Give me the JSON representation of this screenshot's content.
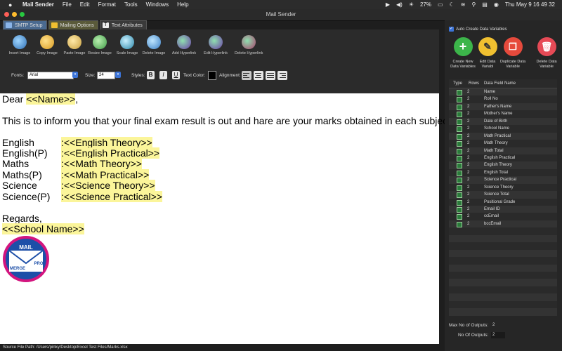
{
  "menubar": {
    "app": "Mail Sender",
    "items": [
      "File",
      "Edit",
      "Format",
      "Tools",
      "Windows",
      "Help"
    ],
    "battery": "27%",
    "clock": "Thu May 9  16 49 32"
  },
  "window": {
    "title": "Mail Sender"
  },
  "tabs": [
    {
      "label": "SMTP Setup"
    },
    {
      "label": "Mailing Options"
    },
    {
      "label": "Text Attributes"
    }
  ],
  "toolbar": {
    "insert_image": "Insert Image",
    "copy_image": "Copy Image",
    "paste_image": "Paste Image",
    "resize_image": "Resize Image",
    "scale_image": "Scale Image",
    "delete_image": "Delete Image",
    "add_hyperlink": "Add Hyperlink",
    "edit_hyperlink": "Edit Hyperlink",
    "delete_hyperlink": "Delete Hyperlink"
  },
  "format": {
    "fonts_label": "Fonts:",
    "font_value": "Arial",
    "size_label": "Size:",
    "size_value": "24",
    "styles_label": "Styles:",
    "bold": "B",
    "italic": "I",
    "underline": "U",
    "text_color_label": "Text Color:",
    "alignment_label": "Alignment:"
  },
  "document": {
    "greeting": "Dear ",
    "name_field": "<<Name>>",
    "greeting_end": ",",
    "intro": "This is to inform you that your final exam result is out and hare are your marks obtained in each subject.",
    "subjects": [
      {
        "label": "English",
        "field": ":<<English Theory>>"
      },
      {
        "label": "English(P)",
        "field": ":<<English Practical>>"
      },
      {
        "label": "Maths",
        "field": ":<<Math Theory>>"
      },
      {
        "label": "Maths(P)",
        "field": ":<<Math Practical>>"
      },
      {
        "label": "Science",
        "field": ":<<Science Theory>>"
      },
      {
        "label": "Science(P)",
        "field": ":<<Science Practical>>"
      }
    ],
    "regards": "Regards,",
    "school_field": "<<School Name>>",
    "logo_text": {
      "top": "MAIL",
      "bottom": "MERGE",
      "badge": "PRO"
    }
  },
  "status": {
    "source_path": "Source File Path: /Users/pinky/Desktop/Excel Test Files/Marks.xlsx"
  },
  "panel": {
    "auto_create_label": "Auto Create Data Variables",
    "buttons": {
      "create": "Create New Data Variables",
      "edit": "Edit Data Variabl",
      "duplicate": "Duplicate Data Variable",
      "delete": "Delete Data Variable"
    },
    "table_headers": {
      "type": "Type",
      "rows": "Rows",
      "field": "Data Field Name"
    },
    "fields": [
      {
        "rows": "2",
        "name": "Name"
      },
      {
        "rows": "2",
        "name": "Roll No"
      },
      {
        "rows": "2",
        "name": "Father's Name"
      },
      {
        "rows": "2",
        "name": "Mother's Name"
      },
      {
        "rows": "2",
        "name": "Date of Birth"
      },
      {
        "rows": "2",
        "name": "School Name"
      },
      {
        "rows": "2",
        "name": "Math Practical"
      },
      {
        "rows": "2",
        "name": "Math Theory"
      },
      {
        "rows": "2",
        "name": "Math Total"
      },
      {
        "rows": "2",
        "name": "English Practical"
      },
      {
        "rows": "2",
        "name": "English Theory"
      },
      {
        "rows": "2",
        "name": "English Total"
      },
      {
        "rows": "2",
        "name": "Science Practical"
      },
      {
        "rows": "2",
        "name": "Science Theory"
      },
      {
        "rows": "2",
        "name": "Science Total"
      },
      {
        "rows": "2",
        "name": "Positional Grade"
      },
      {
        "rows": "2",
        "name": "Email ID"
      },
      {
        "rows": "2",
        "name": "ccEmail"
      },
      {
        "rows": "2",
        "name": "bccEmail"
      }
    ],
    "max_outputs_label": "Max No of Outputs:",
    "max_outputs_value": "2",
    "no_outputs_label": "No Of Outputs:",
    "no_outputs_value": "2"
  },
  "colors": {
    "field_highlight": "#fbf59a",
    "create_btn": "#3cb54a",
    "edit_btn": "#f0c030",
    "duplicate_btn": "#e64a3c",
    "delete_btn": "#e64a56"
  }
}
